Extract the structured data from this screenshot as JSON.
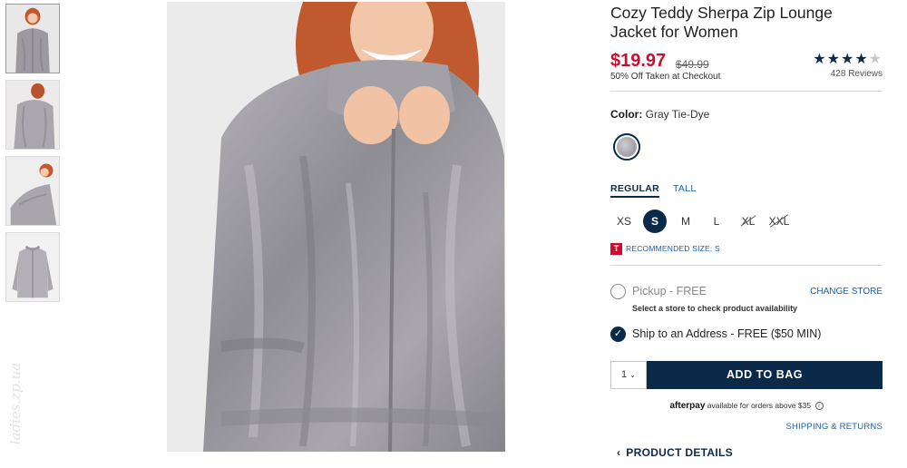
{
  "product": {
    "title": "Cozy Teddy Sherpa Zip Lounge Jacket for Women",
    "price": "$19.97",
    "original_price": "$49.99",
    "discount_note": "50% Off Taken at Checkout",
    "rating": 4,
    "rating_max": 5,
    "reviews": "428 Reviews"
  },
  "color": {
    "label": "Color:",
    "value": "Gray Tie-Dye"
  },
  "fit_tabs": [
    "REGULAR",
    "TALL"
  ],
  "sizes": [
    "XS",
    "S",
    "M",
    "L",
    "XL",
    "XXL"
  ],
  "selected_size": "S",
  "unavailable_sizes": [
    "XL",
    "XXL"
  ],
  "recommended": {
    "icon": "T",
    "text": "RECOMMENDED SIZE: S"
  },
  "fulfillment": {
    "pickup_label": "Pickup - FREE",
    "change_store": "CHANGE STORE",
    "store_note": "Select a store to check product availability",
    "ship_label": "Ship to an Address - FREE ($50 MIN)"
  },
  "cart": {
    "quantity": "1",
    "add_button": "ADD TO BAG"
  },
  "afterpay": {
    "logo": "afterpay",
    "text": "available for orders above $35",
    "info_icon": "i"
  },
  "links": {
    "shipping": "SHIPPING & RETURNS",
    "details": "PRODUCT DETAILS"
  },
  "watermark": "ladies.zp.ua",
  "colors": {
    "navy": "#0b2a4a",
    "sale_red": "#c8102e",
    "link_blue": "#1d5fa3"
  },
  "icons": {
    "checkmark": "checkmark-icon",
    "chevron_down": "chevron-down-icon",
    "chevron_left": "chevron-left-icon"
  }
}
